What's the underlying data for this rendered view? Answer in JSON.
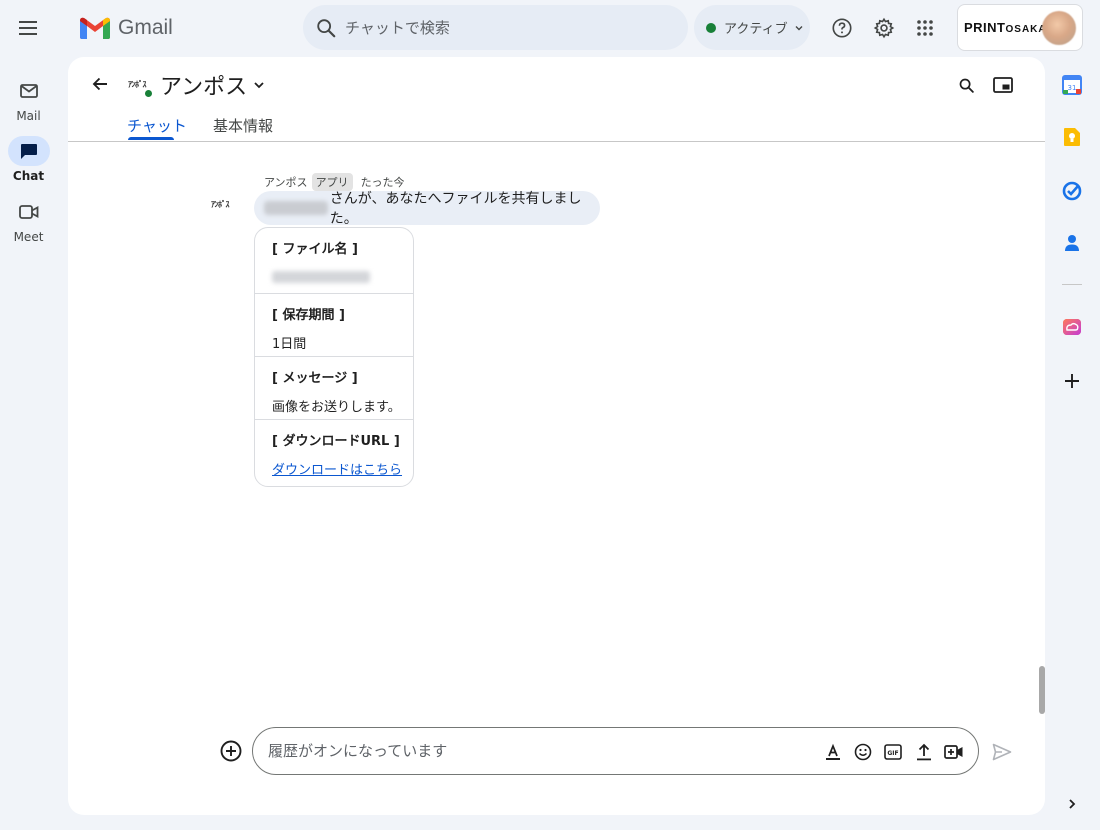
{
  "app": {
    "name": "Gmail"
  },
  "search": {
    "placeholder": "チャットで検索"
  },
  "status": {
    "label": "アクティブ",
    "color": "#188038"
  },
  "account": {
    "brand_main": "PRINT",
    "brand_small": "OSAKA"
  },
  "rail": {
    "items": [
      {
        "label": "Mail",
        "icon": "mail-icon"
      },
      {
        "label": "Chat",
        "icon": "chat-icon",
        "active": true
      },
      {
        "label": "Meet",
        "icon": "meet-icon"
      }
    ]
  },
  "space": {
    "logo_text": "ｱﾝﾎﾟｽ",
    "name": "アンポス"
  },
  "tabs": [
    {
      "label": "チャット",
      "active": true
    },
    {
      "label": "基本情報",
      "active": false
    }
  ],
  "message": {
    "sender": "アンポス",
    "badge": "アプリ",
    "time": "たった今",
    "avatar_text": "ｱﾝﾎﾟｽ",
    "text": "さんが、あなたへファイルを共有しました。",
    "card": [
      {
        "title": "[ ファイル名 ]",
        "value": ""
      },
      {
        "title": "[ 保存期間 ]",
        "value": "1日間"
      },
      {
        "title": "[ メッセージ ]",
        "value": "画像をお送りします。"
      },
      {
        "title": "[ ダウンロードURL ]",
        "value": "ダウンロードはこちら"
      }
    ]
  },
  "composer": {
    "placeholder": "履歴がオンになっています"
  },
  "colors": {
    "accent": "#0b57d0",
    "panel_bg": "#ffffff",
    "page_bg": "#f1f4f9"
  }
}
